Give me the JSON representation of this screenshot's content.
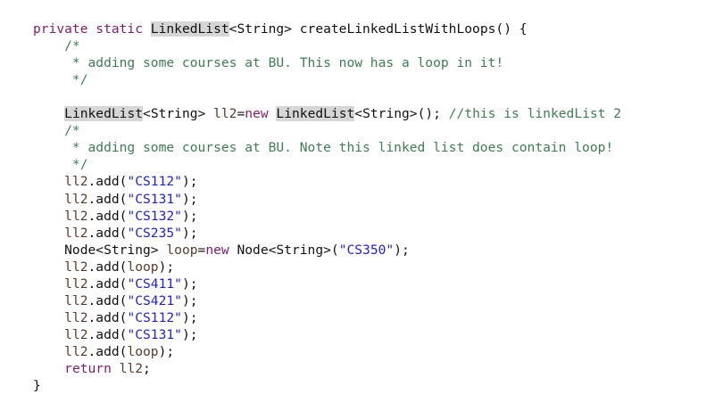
{
  "code": {
    "lines": [
      [
        {
          "t": "private static ",
          "c": "kw"
        },
        {
          "t": "LinkedList",
          "c": "hl"
        },
        {
          "t": "<String> createLinkedListWithLoops() {",
          "c": "plain"
        }
      ],
      [
        {
          "t": "    /*",
          "c": "cm"
        }
      ],
      [
        {
          "t": "     * adding some courses at BU. This now has a loop in it!",
          "c": "cm"
        }
      ],
      [
        {
          "t": "     */",
          "c": "cm"
        }
      ],
      [],
      [
        {
          "t": "    ",
          "c": "plain"
        },
        {
          "t": "LinkedList",
          "c": "hl"
        },
        {
          "t": "<String> ",
          "c": "plain"
        },
        {
          "t": "ll2",
          "c": "var"
        },
        {
          "t": "=",
          "c": "plain"
        },
        {
          "t": "new",
          "c": "kw"
        },
        {
          "t": " ",
          "c": "plain"
        },
        {
          "t": "LinkedList",
          "c": "hl"
        },
        {
          "t": "<String>(); ",
          "c": "plain"
        },
        {
          "t": "//this is linkedList 2",
          "c": "cm"
        }
      ],
      [
        {
          "t": "    /*",
          "c": "cm"
        }
      ],
      [
        {
          "t": "     * adding some courses at BU. Note this linked list does contain loop!",
          "c": "cm"
        }
      ],
      [
        {
          "t": "     */",
          "c": "cm"
        }
      ],
      [
        {
          "t": "    ",
          "c": "plain"
        },
        {
          "t": "ll2",
          "c": "var"
        },
        {
          "t": ".add(",
          "c": "plain"
        },
        {
          "t": "\"CS112\"",
          "c": "str"
        },
        {
          "t": ");",
          "c": "plain"
        }
      ],
      [
        {
          "t": "    ",
          "c": "plain"
        },
        {
          "t": "ll2",
          "c": "var"
        },
        {
          "t": ".add(",
          "c": "plain"
        },
        {
          "t": "\"CS131\"",
          "c": "str"
        },
        {
          "t": ");",
          "c": "plain"
        }
      ],
      [
        {
          "t": "    ",
          "c": "plain"
        },
        {
          "t": "ll2",
          "c": "var"
        },
        {
          "t": ".add(",
          "c": "plain"
        },
        {
          "t": "\"CS132\"",
          "c": "str"
        },
        {
          "t": ");",
          "c": "plain"
        }
      ],
      [
        {
          "t": "    ",
          "c": "plain"
        },
        {
          "t": "ll2",
          "c": "var"
        },
        {
          "t": ".add(",
          "c": "plain"
        },
        {
          "t": "\"CS235\"",
          "c": "str"
        },
        {
          "t": ");",
          "c": "plain"
        }
      ],
      [
        {
          "t": "    Node<String> ",
          "c": "plain"
        },
        {
          "t": "loop",
          "c": "var"
        },
        {
          "t": "=",
          "c": "plain"
        },
        {
          "t": "new",
          "c": "kw"
        },
        {
          "t": " Node<String>(",
          "c": "plain"
        },
        {
          "t": "\"CS350\"",
          "c": "str"
        },
        {
          "t": ");",
          "c": "plain"
        }
      ],
      [
        {
          "t": "    ",
          "c": "plain"
        },
        {
          "t": "ll2",
          "c": "var"
        },
        {
          "t": ".add(",
          "c": "plain"
        },
        {
          "t": "loop",
          "c": "var"
        },
        {
          "t": ");",
          "c": "plain"
        }
      ],
      [
        {
          "t": "    ",
          "c": "plain"
        },
        {
          "t": "ll2",
          "c": "var"
        },
        {
          "t": ".add(",
          "c": "plain"
        },
        {
          "t": "\"CS411\"",
          "c": "str"
        },
        {
          "t": ");",
          "c": "plain"
        }
      ],
      [
        {
          "t": "    ",
          "c": "plain"
        },
        {
          "t": "ll2",
          "c": "var"
        },
        {
          "t": ".add(",
          "c": "plain"
        },
        {
          "t": "\"CS421\"",
          "c": "str"
        },
        {
          "t": ");",
          "c": "plain"
        }
      ],
      [
        {
          "t": "    ",
          "c": "plain"
        },
        {
          "t": "ll2",
          "c": "var"
        },
        {
          "t": ".add(",
          "c": "plain"
        },
        {
          "t": "\"CS112\"",
          "c": "str"
        },
        {
          "t": ");",
          "c": "plain"
        }
      ],
      [
        {
          "t": "    ",
          "c": "plain"
        },
        {
          "t": "ll2",
          "c": "var"
        },
        {
          "t": ".add(",
          "c": "plain"
        },
        {
          "t": "\"CS131\"",
          "c": "str"
        },
        {
          "t": ");",
          "c": "plain"
        }
      ],
      [
        {
          "t": "    ",
          "c": "plain"
        },
        {
          "t": "ll2",
          "c": "var"
        },
        {
          "t": ".add(",
          "c": "plain"
        },
        {
          "t": "loop",
          "c": "var"
        },
        {
          "t": ");",
          "c": "plain"
        }
      ],
      [
        {
          "t": "    ",
          "c": "plain"
        },
        {
          "t": "return",
          "c": "kw"
        },
        {
          "t": " ",
          "c": "plain"
        },
        {
          "t": "ll2",
          "c": "var"
        },
        {
          "t": ";",
          "c": "plain"
        }
      ],
      [
        {
          "t": "}",
          "c": "plain"
        }
      ]
    ]
  },
  "colors": {
    "keyword": "#7f1d6a",
    "comment": "#3e7d54",
    "string": "#2222cc",
    "variable": "#5a3a2a",
    "highlight": "#d6d6d6"
  }
}
